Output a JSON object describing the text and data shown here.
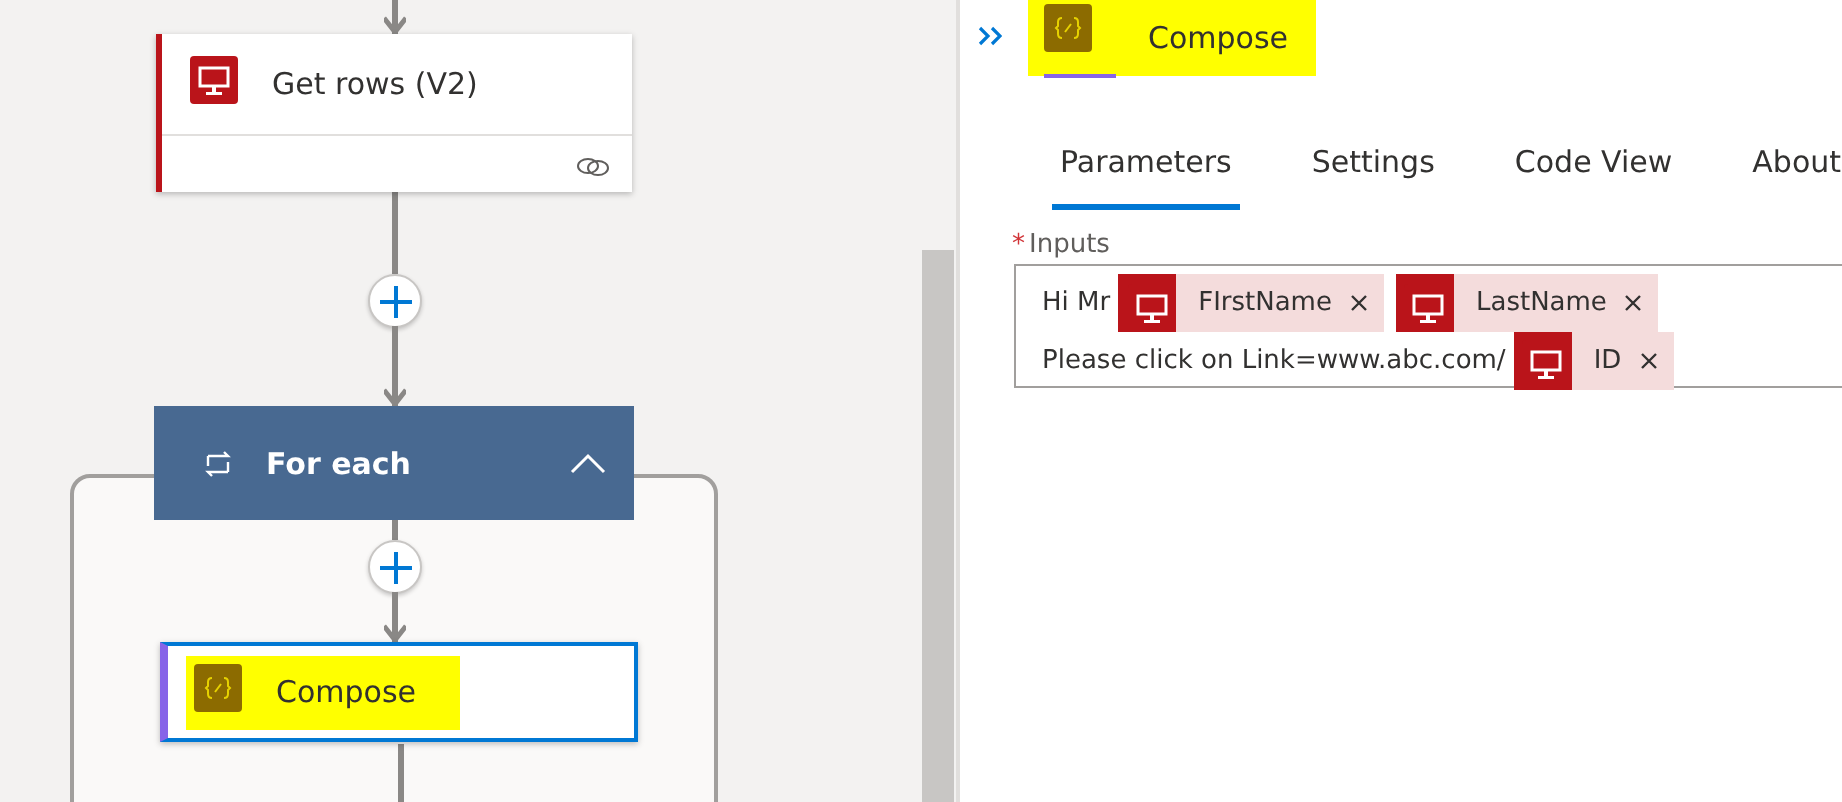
{
  "canvas": {
    "nodes": [
      {
        "kind": "sql",
        "title": "Get rows (V2)",
        "selected": false
      },
      {
        "kind": "loop",
        "title": "For each",
        "expanded": true
      },
      {
        "kind": "compose",
        "title": "Compose",
        "selected": true
      }
    ]
  },
  "panel": {
    "title": "Compose",
    "tabs": [
      {
        "label": "Parameters",
        "selected": true
      },
      {
        "label": "Settings",
        "selected": false
      },
      {
        "label": "Code View",
        "selected": false
      },
      {
        "label": "About",
        "selected": false
      }
    ],
    "field": {
      "label": "Inputs",
      "required_mark": "*",
      "lines": [
        [
          {
            "kind": "text",
            "text": "Hi Mr"
          },
          {
            "kind": "token",
            "text": "FIrstName"
          },
          {
            "kind": "token",
            "text": "LastName"
          }
        ],
        [
          {
            "kind": "text",
            "text": "Please click on Link=www.abc.com/"
          },
          {
            "kind": "token",
            "text": "ID"
          }
        ]
      ]
    }
  }
}
